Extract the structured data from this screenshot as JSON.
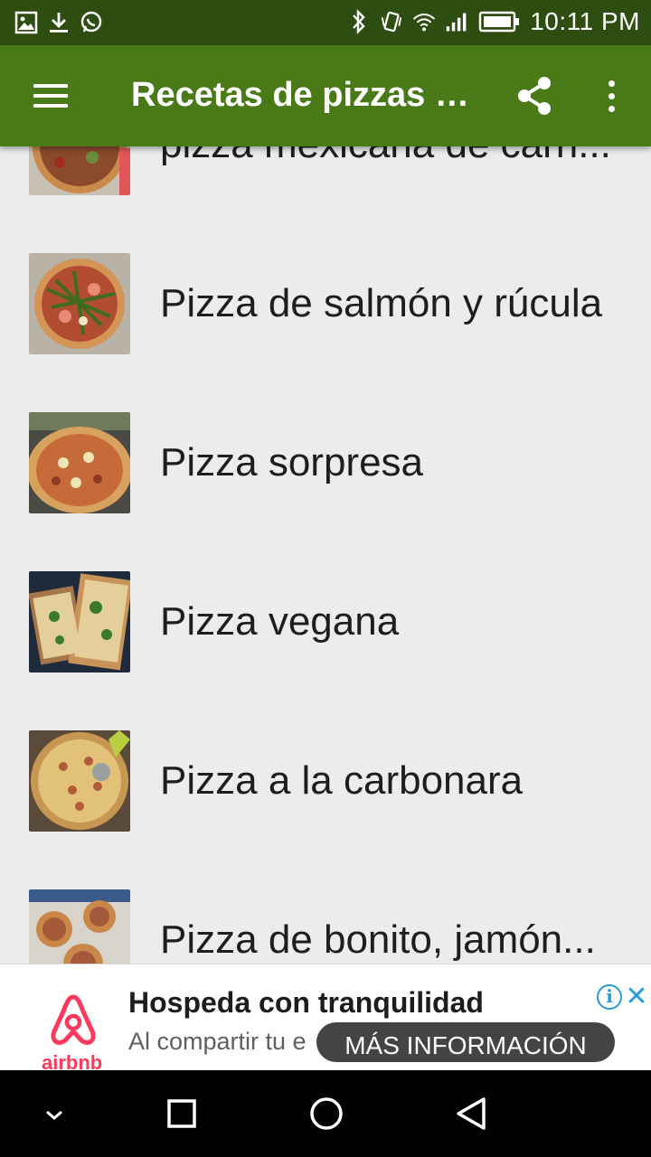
{
  "status_bar": {
    "time": "10:11 PM",
    "icons": [
      "gallery-icon",
      "download-icon",
      "whatsapp-icon",
      "bluetooth-icon",
      "vibrate-icon",
      "wifi-icon",
      "signal-icon",
      "battery-icon"
    ]
  },
  "app_bar": {
    "title": "Recetas de pizzas f...",
    "color": "#4a7a17",
    "actions": [
      "share-icon",
      "more-vert-icon"
    ]
  },
  "list": {
    "items": [
      {
        "label": "pizza mexicana de carn...",
        "thumb": "pizza-photo"
      },
      {
        "label": "Pizza de salmón y rúcula",
        "thumb": "pizza-photo"
      },
      {
        "label": "Pizza sorpresa",
        "thumb": "pizza-photo"
      },
      {
        "label": "Pizza vegana",
        "thumb": "pizza-photo"
      },
      {
        "label": "Pizza a la carbonara",
        "thumb": "pizza-photo"
      },
      {
        "label": "Pizza de bonito, jamón...",
        "thumb": "pizza-photo"
      }
    ]
  },
  "ad": {
    "title": "Hospeda con tranquilidad",
    "subtitle": "Al compartir tu e",
    "brand": "airbnb",
    "cta": "MÁS INFORMACIÓN",
    "brand_color": "#ff385c"
  },
  "nav_bar": {
    "buttons": [
      "chevron-down-icon",
      "recents-icon",
      "home-icon",
      "back-icon"
    ]
  }
}
